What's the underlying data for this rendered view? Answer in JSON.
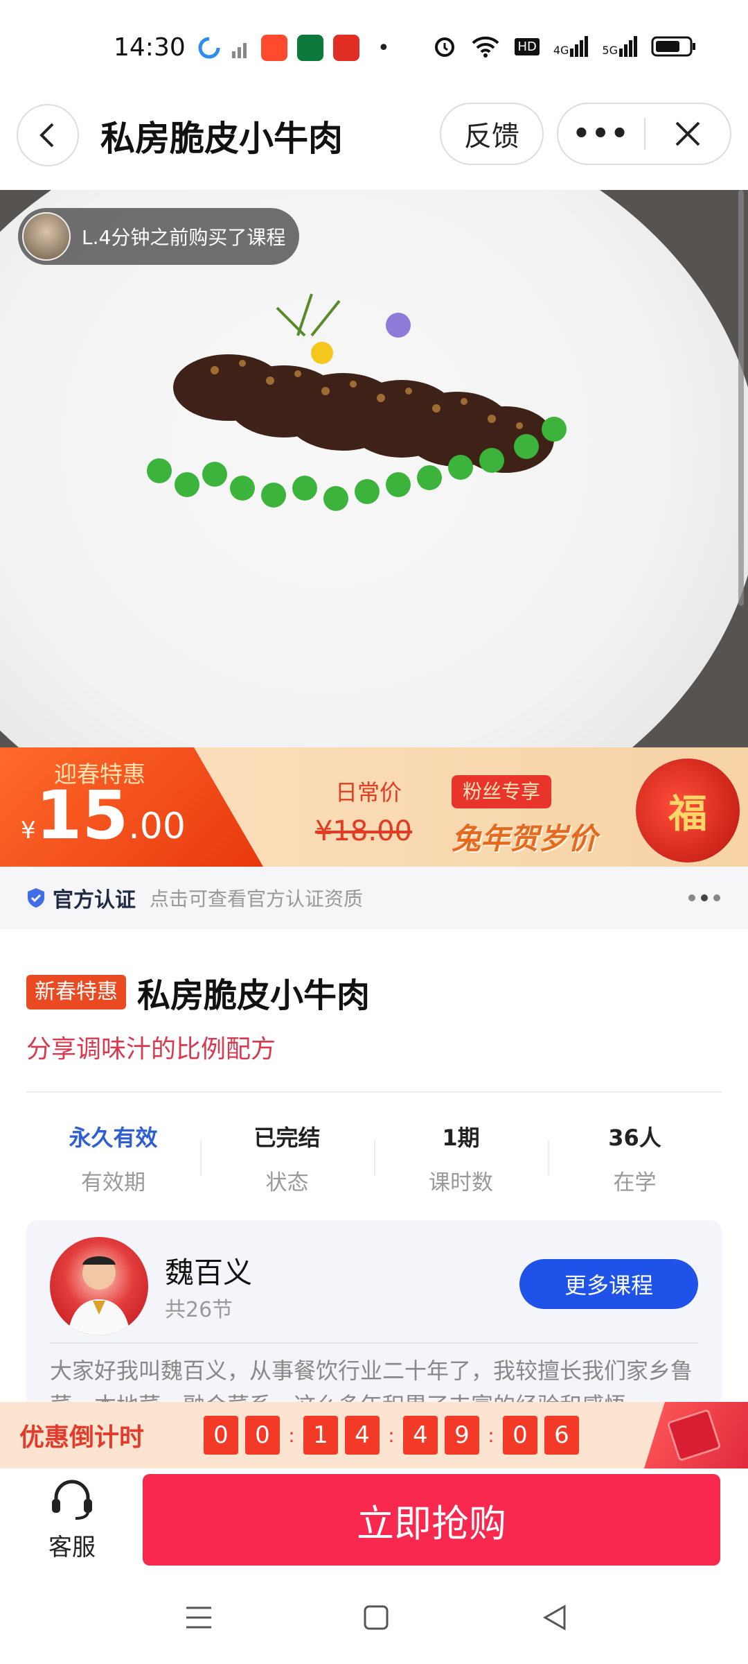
{
  "status_bar": {
    "time": "14:30",
    "network_labels": [
      "4G",
      "5G"
    ],
    "hd_label": "HD"
  },
  "nav": {
    "title": "私房脆皮小牛肉",
    "feedback_label": "反馈",
    "more_label": "•••"
  },
  "hero": {
    "buyer_tip": "L.4分钟之前购买了课程"
  },
  "price": {
    "promo_label": "迎春特惠",
    "currency": "¥",
    "integer": "15",
    "decimal": ".00",
    "daily_label": "日常价",
    "old_price": "¥18.00",
    "fans_badge": "粉丝专享",
    "rabbit_text": "兔年贺岁价",
    "fu_char": "福"
  },
  "auth": {
    "label": "官方认证",
    "hint": "点击可查看官方认证资质"
  },
  "course": {
    "tag": "新春特惠",
    "title": "私房脆皮小牛肉",
    "subtitle": "分享调味汁的比例配方"
  },
  "stats": [
    {
      "value": "永久有效",
      "label": "有效期"
    },
    {
      "value": "已完结",
      "label": "状态"
    },
    {
      "value": "1期",
      "label": "课时数"
    },
    {
      "value": "36人",
      "label": "在学"
    }
  ],
  "teacher": {
    "name": "魏百义",
    "count": "共26节",
    "more_button": "更多课程",
    "intro": "大家好我叫魏百义，从事餐饮行业二十年了，我较擅长我们家乡鲁菜、本地菜、融合菜系，这么多年积累了丰富的经验和感悟"
  },
  "countdown": {
    "label": "优惠倒计时",
    "digits": [
      "0",
      "0",
      "1",
      "4",
      "4",
      "9",
      "0",
      "6"
    ]
  },
  "actions": {
    "service_label": "客服",
    "buy_label": "立即抢购"
  },
  "colors": {
    "accent_red": "#f8284e",
    "promo_orange": "#e8380e",
    "blue": "#1f52e8"
  }
}
